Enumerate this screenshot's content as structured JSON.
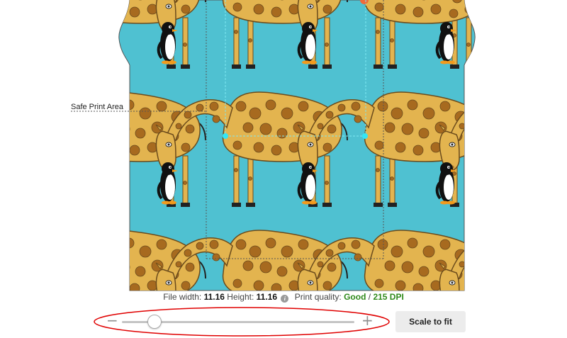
{
  "design": {
    "safe_area_label": "Safe Print Area",
    "background_color": "#4fc1d1",
    "pattern_motifs": [
      "giraffe",
      "penguin"
    ]
  },
  "info": {
    "file_width_label": "File width:",
    "file_width_value": "11.16",
    "height_label": "Height:",
    "height_value": "11.16",
    "info_icon": "info-icon",
    "print_quality_label": "Print quality:",
    "print_quality_value": "Good",
    "separator": "/",
    "dpi_value": "215 DPI",
    "quality_color": "#2f8a1b"
  },
  "zoom": {
    "minus_label": "−",
    "plus_label": "+",
    "level": 0.14,
    "highlight_color": "#e00000"
  },
  "actions": {
    "scale_to_fit_label": "Scale to fit"
  }
}
